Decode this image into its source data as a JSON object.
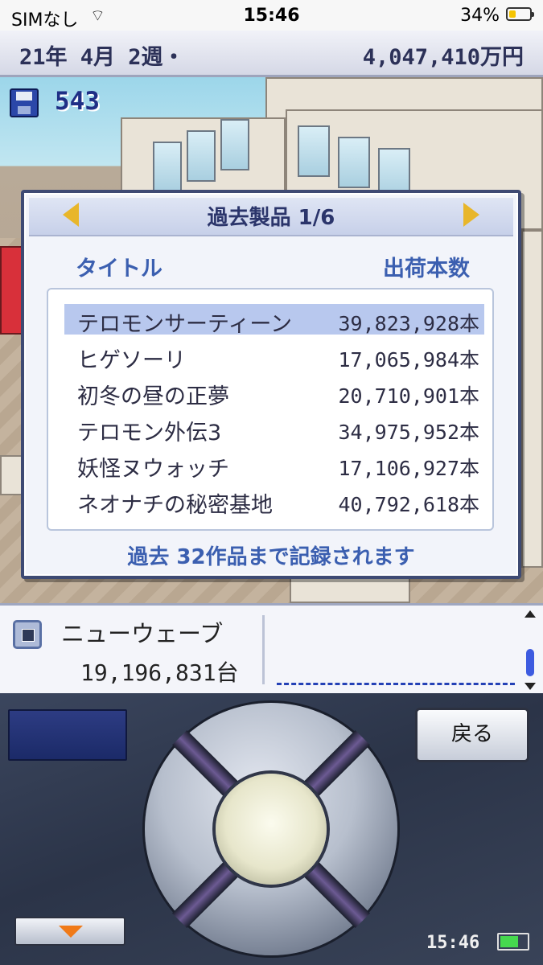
{
  "status_bar": {
    "carrier": "SIMなし",
    "time": "15:46",
    "battery_percent": "34%",
    "battery_level": 0.34
  },
  "top_bar": {
    "date": "21年 4月 2週・",
    "money": "4,047,410万円"
  },
  "save": {
    "count": "543"
  },
  "dialog": {
    "title": "過去製品 1/6",
    "col_title": "タイトル",
    "col_shipments": "出荷本数",
    "rows": [
      {
        "title": "テロモンサーティーン",
        "shipments": "39,823,928本",
        "selected": true
      },
      {
        "title": "ヒゲソーリ",
        "shipments": "17,065,984本",
        "selected": false
      },
      {
        "title": "初冬の昼の正夢",
        "shipments": "20,710,901本",
        "selected": false
      },
      {
        "title": "テロモン外伝3",
        "shipments": "34,975,952本",
        "selected": false
      },
      {
        "title": "妖怪ヌウォッチ",
        "shipments": "17,106,927本",
        "selected": false
      },
      {
        "title": "ネオナチの秘密基地",
        "shipments": "40,792,618本",
        "selected": false
      }
    ],
    "footer": "過去 32作品まで記録されます"
  },
  "console_panel": {
    "name": "ニューウェーブ",
    "units": "19,196,831台"
  },
  "controller": {
    "back_label": "戻る",
    "clock": "15:46",
    "battery_level": 0.7
  },
  "colors": {
    "accent": "#3b5fb0",
    "selection": "#b8c8ee",
    "arrow": "#e8b62a",
    "down_arrow": "#f07a18"
  }
}
